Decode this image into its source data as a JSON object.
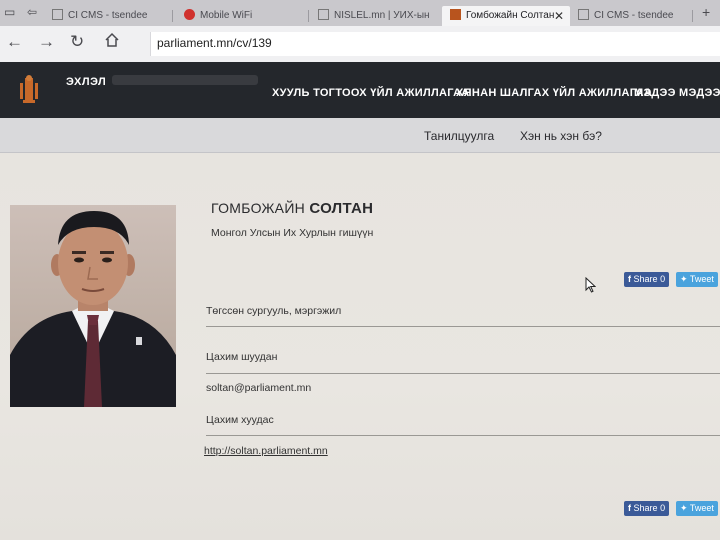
{
  "browser": {
    "tabs": [
      {
        "label": "CI CMS - tsendee",
        "active": false
      },
      {
        "label": "Mobile WiFi",
        "active": false
      },
      {
        "label": "NISLEL.mn | УИХ-ын",
        "active": false
      },
      {
        "label": "Гомбожайн Солтан",
        "active": true
      },
      {
        "label": "CI CMS - tsendee",
        "active": false
      }
    ],
    "url": "parliament.mn/cv/139"
  },
  "site": {
    "home_label": "ЭХЛЭЛ",
    "nav_items": [
      {
        "label": "ХУУЛЬ ТОГТООХ ҮЙЛ АЖИЛЛАГАА"
      },
      {
        "label": "ХЯНАН ШАЛГАХ ҮЙЛ АЖИЛЛАГАА"
      },
      {
        "label": "МЭДЭЭ МЭДЭЭЛЭЛ"
      }
    ],
    "subnav": [
      {
        "label": "Танилцуулга"
      },
      {
        "label": "Хэн нь хэн бэ?"
      }
    ]
  },
  "profile": {
    "first_name": "ГОМБОЖАЙН",
    "surname": "СОЛТАН",
    "role": "Монгол Улсын Их Хурлын гишүүн",
    "share": {
      "facebook_label": "Share",
      "facebook_count": "0",
      "tweet_label": "Tweet"
    },
    "education_label": "Төгссөн сургууль, мэргэжил",
    "email_label": "Цахим шуудан",
    "email": "soltan@parliament.mn",
    "website_label": "Цахим хуудас",
    "website": "http://soltan.parliament.mn"
  },
  "colors": {
    "header_bg": "#24272c",
    "facebook": "#3b5a98",
    "twitter": "#4aa3dd"
  }
}
